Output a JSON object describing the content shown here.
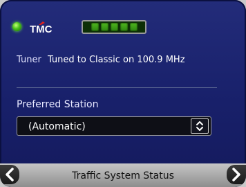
{
  "status": {
    "tmc_logo_text": "TMC",
    "signal_bars_total": 5,
    "signal_bars_filled": 5,
    "led_color": "#49c21a"
  },
  "tuner": {
    "label": "Tuner",
    "value": "Tuned to Classic on 100.9 MHz"
  },
  "preferred_station": {
    "label": "Preferred Station",
    "selected": "(Automatic)"
  },
  "bottom_bar": {
    "title": "Traffic System Status",
    "left_icon": "chevron-left-icon",
    "right_icon": "chevron-right-icon"
  },
  "colors": {
    "panel": "#1c2470",
    "accent_green": "#49c21a",
    "logo_red": "#e0201e"
  }
}
